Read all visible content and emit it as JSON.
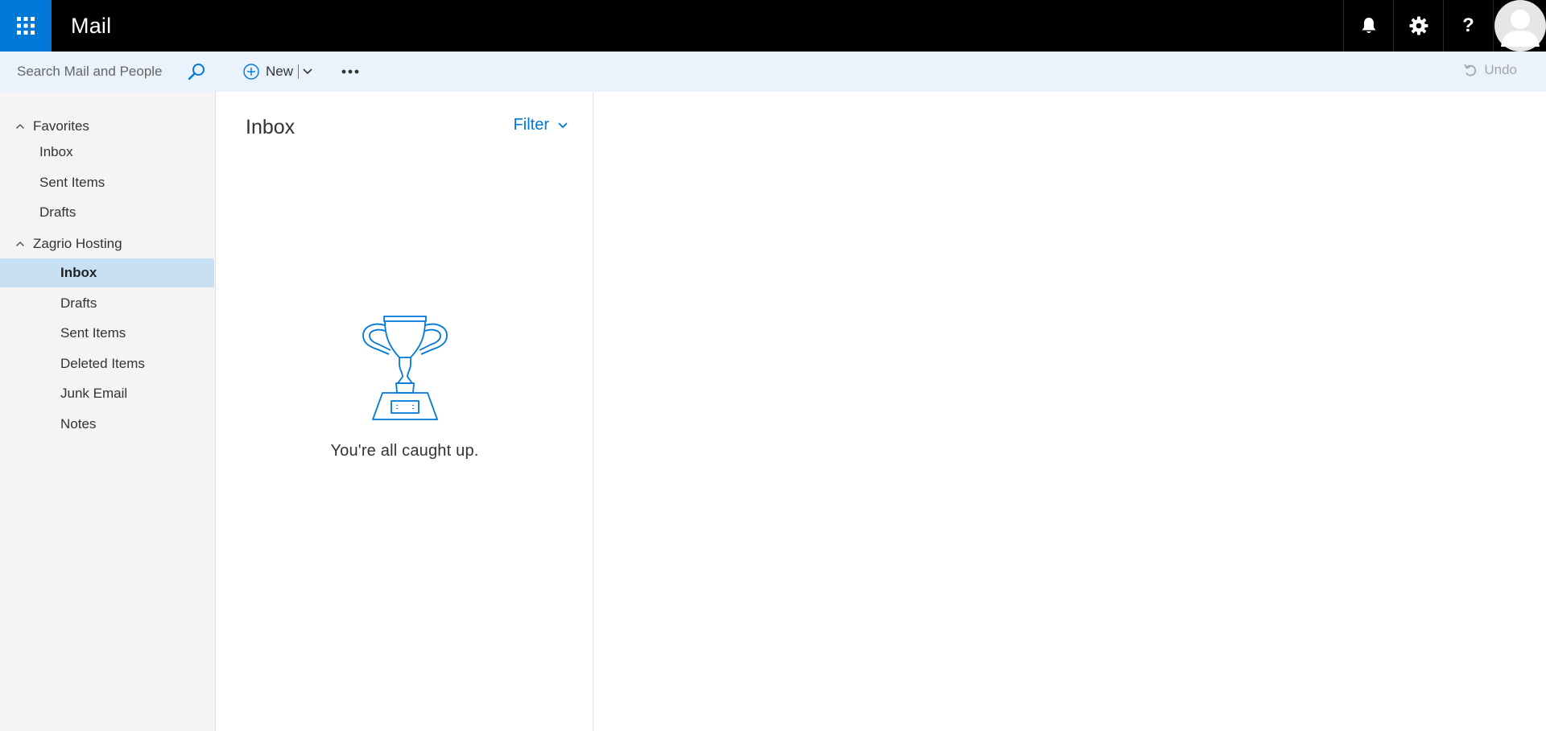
{
  "header": {
    "app_title": "Mail",
    "launcher_icon": "waffle-icon",
    "actions": [
      {
        "name": "notifications",
        "icon": "bell-icon"
      },
      {
        "name": "settings",
        "icon": "gear-icon"
      },
      {
        "name": "help",
        "icon": "question-icon",
        "glyph": "?"
      }
    ],
    "avatar_icon": "person-icon"
  },
  "command_bar": {
    "search_placeholder": "Search Mail and People",
    "new_label": "New",
    "undo_label": "Undo"
  },
  "nav": {
    "favorites": {
      "label": "Favorites",
      "items": [
        "Inbox",
        "Sent Items",
        "Drafts"
      ]
    },
    "account": {
      "label": "Zagrio Hosting",
      "items": [
        "Inbox",
        "Drafts",
        "Sent Items",
        "Deleted Items",
        "Junk Email",
        "Notes"
      ],
      "selected": "Inbox"
    }
  },
  "message_list": {
    "title": "Inbox",
    "filter_label": "Filter",
    "empty_message": "You're all caught up.",
    "empty_icon": "trophy-icon"
  },
  "colors": {
    "accent": "#0078d7",
    "topbar": "#000000",
    "command_bar": "#eaf3fb",
    "nav_background": "#f4f4f4",
    "selected_item": "#c7e0f4",
    "disabled_text": "#a6a6a6"
  }
}
